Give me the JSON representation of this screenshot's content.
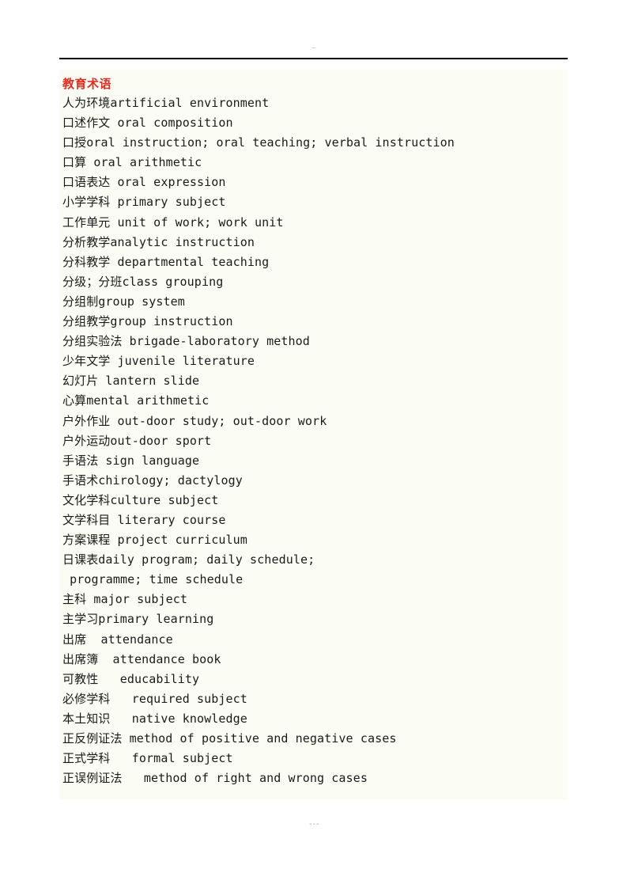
{
  "header": {
    "rule_mark": "–"
  },
  "footer": {
    "page_mark": "---"
  },
  "content": {
    "section_title": "教育术语",
    "title_color": "#d93025",
    "background_color": "#fbfdf4",
    "terms": [
      {
        "zh": "人为环境",
        "en": "artificial environment",
        "line": "人为环境artificial environment"
      },
      {
        "zh": "口述作文",
        "en": "oral composition",
        "line": "口述作文 oral composition"
      },
      {
        "zh": "口授",
        "en": "oral instruction; oral teaching; verbal instruction",
        "line": "口授oral instruction; oral teaching; verbal instruction"
      },
      {
        "zh": "口算",
        "en": "oral arithmetic",
        "line": "口算 oral arithmetic"
      },
      {
        "zh": "口语表达",
        "en": "oral expression",
        "line": "口语表达 oral expression"
      },
      {
        "zh": "小学学科",
        "en": "primary subject",
        "line": "小学学科 primary subject"
      },
      {
        "zh": "工作单元",
        "en": "unit of work; work unit",
        "line": "工作单元 unit of work; work unit"
      },
      {
        "zh": "分析教学",
        "en": "analytic instruction",
        "line": "分析教学analytic instruction"
      },
      {
        "zh": "分科教学",
        "en": "departmental teaching",
        "line": "分科教学 departmental teaching"
      },
      {
        "zh": "分级；分班",
        "en": "class grouping",
        "line": "分级；分班class grouping"
      },
      {
        "zh": "分组制",
        "en": "group system",
        "line": "分组制group system"
      },
      {
        "zh": "分组教学",
        "en": "group instruction",
        "line": "分组教学group instruction"
      },
      {
        "zh": "分组实验法",
        "en": "brigade-laboratory method",
        "line": "分组实验法 brigade-laboratory method"
      },
      {
        "zh": "少年文学",
        "en": "juvenile literature",
        "line": "少年文学 juvenile literature"
      },
      {
        "zh": "幻灯片",
        "en": "lantern slide",
        "line": "幻灯片 lantern slide"
      },
      {
        "zh": "心算",
        "en": "mental arithmetic",
        "line": "心算mental arithmetic"
      },
      {
        "zh": "户外作业",
        "en": "out-door study; out-door work",
        "line": "户外作业 out-door study; out-door work"
      },
      {
        "zh": "户外运动",
        "en": "out-door sport",
        "line": "户外运动out-door sport"
      },
      {
        "zh": "手语法",
        "en": "sign language",
        "line": "手语法 sign language"
      },
      {
        "zh": "手语术",
        "en": "chirology; dactylogy",
        "line": "手语术chirology; dactylogy"
      },
      {
        "zh": "文化学科",
        "en": "culture subject",
        "line": "文化学科culture subject"
      },
      {
        "zh": "文学科目",
        "en": "literary course",
        "line": "文学科目 literary course"
      },
      {
        "zh": "方案课程",
        "en": "project curriculum",
        "line": "方案课程 project curriculum"
      },
      {
        "zh": "日课表",
        "en": "daily program; daily schedule;",
        "line": "日课表daily program; daily schedule;"
      },
      {
        "zh": "",
        "en": "programme; time schedule",
        "line": " programme; time schedule"
      },
      {
        "zh": "主科",
        "en": "major subject",
        "line": "主科 major subject"
      },
      {
        "zh": "主学习",
        "en": "primary learning",
        "line": "主学习primary learning"
      },
      {
        "zh": "出席",
        "en": "attendance",
        "line": "出席  attendance"
      },
      {
        "zh": "出席簿",
        "en": "attendance book",
        "line": "出席簿  attendance book"
      },
      {
        "zh": "可教性",
        "en": "educability",
        "line": "可教性   educability"
      },
      {
        "zh": "必修学科",
        "en": "required subject",
        "line": "必修学科   required subject"
      },
      {
        "zh": "本土知识",
        "en": "native knowledge",
        "line": "本土知识   native knowledge"
      },
      {
        "zh": "正反例证法",
        "en": "method of positive and negative cases",
        "line": "正反例证法 method of positive and negative cases"
      },
      {
        "zh": "正式学科",
        "en": "formal subject",
        "line": "正式学科   formal subject"
      },
      {
        "zh": "正误例证法",
        "en": "method of right and wrong cases",
        "line": "正误例证法   method of right and wrong cases"
      }
    ]
  }
}
